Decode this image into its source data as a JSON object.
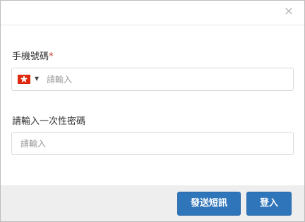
{
  "dialog": {
    "close_symbol": "×"
  },
  "phone": {
    "label": "手機號碼",
    "required_mark": "*",
    "placeholder": "請輸入",
    "value": "",
    "country_flag_icon": "hong-kong-flag",
    "caret_symbol": "▼"
  },
  "otp": {
    "label": "請輸入一次性密碼",
    "placeholder": "請輸入",
    "value": ""
  },
  "footer": {
    "send_sms_label": "發送短訊",
    "login_label": "登入"
  },
  "colors": {
    "primary_button": "#2f75ba",
    "footer_background": "#eeeeee",
    "required_mark": "#c0392b",
    "flag_red": "#de2910"
  }
}
